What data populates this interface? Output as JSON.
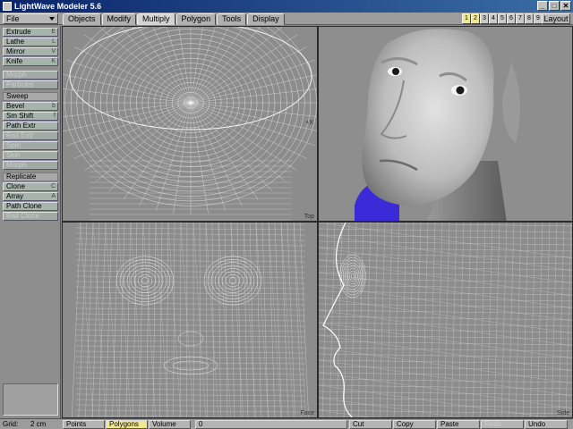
{
  "window": {
    "title": "LightWave Modeler 5.6",
    "buttons": [
      "_",
      "□",
      "✕"
    ]
  },
  "toolbar": {
    "file_label": "File",
    "tabs": [
      {
        "label": "Objects"
      },
      {
        "label": "Modify"
      },
      {
        "label": "Multiply",
        "active": true
      },
      {
        "label": "Polygon"
      },
      {
        "label": "Tools"
      },
      {
        "label": "Display"
      }
    ],
    "layer_buttons": [
      "1",
      "2",
      "3",
      "4",
      "5",
      "6",
      "7",
      "8",
      "9",
      "10"
    ],
    "layout_label": "Layout"
  },
  "sidebar": {
    "tools_group1": [
      {
        "label": "Extrude",
        "key": "E",
        "enabled": true
      },
      {
        "label": "Lathe",
        "key": "L",
        "enabled": true
      },
      {
        "label": "Mirror",
        "key": "V",
        "enabled": true
      },
      {
        "label": "Knife",
        "key": "K",
        "enabled": true
      }
    ],
    "tools_group2": [
      {
        "label": "Morph",
        "enabled": false
      },
      {
        "label": "Particles",
        "enabled": false
      }
    ],
    "sweep_label": "Sweep",
    "tools_sweep": [
      {
        "label": "Bevel",
        "key": "b",
        "enabled": true
      },
      {
        "label": "Sm Shift",
        "key": "f",
        "enabled": true
      },
      {
        "label": "Path Extr",
        "enabled": true
      },
      {
        "label": "Rail Extr",
        "enabled": false
      },
      {
        "label": "Spin",
        "enabled": false
      },
      {
        "label": "Skin",
        "enabled": false
      },
      {
        "label": "Morph",
        "enabled": false
      }
    ],
    "replicate_label": "Replicate",
    "tools_replicate": [
      {
        "label": "Clone",
        "key": "C",
        "enabled": true
      },
      {
        "label": "Array",
        "key": "A",
        "enabled": true
      },
      {
        "label": "Path Clone",
        "enabled": true
      },
      {
        "label": "Rail Clone",
        "enabled": false
      }
    ]
  },
  "viewports": {
    "top_label": "Top",
    "front_label": "Face",
    "side_label": "Side",
    "axis_marker": "+X"
  },
  "bottom": {
    "grid_label": "Grid:",
    "grid_value": "2 cm",
    "modes": [
      {
        "label": "Points",
        "selected": false
      },
      {
        "label": "Polygons",
        "selected": true
      },
      {
        "label": "Volume",
        "selected": false
      }
    ],
    "count": "0",
    "edit": [
      {
        "label": "Cut",
        "enabled": true
      },
      {
        "label": "Copy",
        "enabled": true
      },
      {
        "label": "Paste",
        "enabled": true
      },
      {
        "label": "Redo",
        "enabled": false
      },
      {
        "label": "Undo",
        "enabled": true
      }
    ]
  },
  "colors": {
    "wire": "#ffffff",
    "viewport_bg": "#8c8c8c",
    "skin": "#c4c4c4",
    "shirt": "#3a2ad8"
  }
}
